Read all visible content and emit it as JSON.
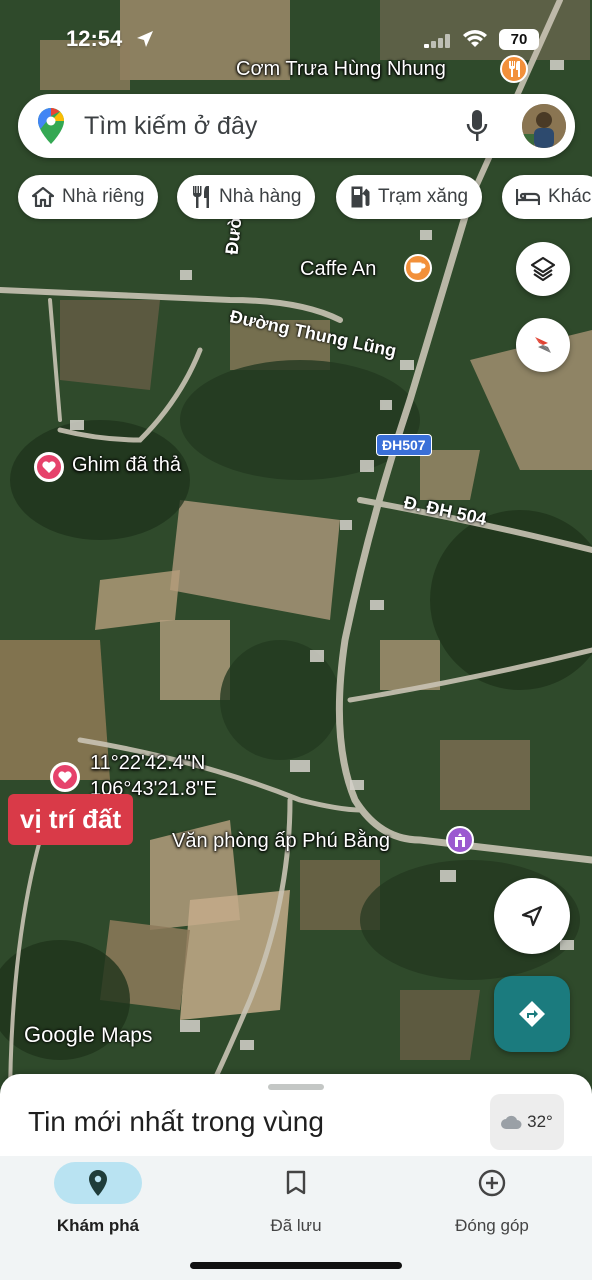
{
  "status_bar": {
    "time": "12:54",
    "battery": "70"
  },
  "search": {
    "placeholder": "Tìm kiếm ở đây"
  },
  "chips": [
    {
      "label": "Nhà riêng",
      "icon": "home-icon"
    },
    {
      "label": "Nhà hàng",
      "icon": "restaurant-icon"
    },
    {
      "label": "Trạm xăng",
      "icon": "gas-station-icon"
    },
    {
      "label": "Khác",
      "icon": "hotel-icon"
    }
  ],
  "map": {
    "pois": {
      "restaurant": "Cơm Trưa Hùng Nhung",
      "cafe": "Caffe An",
      "dropped_pin": "Ghim đã thả",
      "office": "Văn phòng ấp Phú Bằng"
    },
    "roads": {
      "duong_vertical": "Đường",
      "thung_lung": "Đường Thung Lũng",
      "dh507": "ĐH507",
      "dh504": "Đ. ĐH 504"
    },
    "coordinates": {
      "lat": "11°22'42.4\"N",
      "lng": "106°43'21.8\"E"
    },
    "marker_label": "vị trí đất",
    "watermark_google": "Google",
    "watermark_maps": "Maps"
  },
  "sheet": {
    "title": "Tin mới nhất trong vùng",
    "temperature": "32°"
  },
  "nav": [
    {
      "label": "Khám phá",
      "icon": "explore-pin-icon",
      "active": true
    },
    {
      "label": "Đã lưu",
      "icon": "bookmark-icon",
      "active": false
    },
    {
      "label": "Đóng góp",
      "icon": "add-circle-icon",
      "active": false
    }
  ],
  "colors": {
    "accent_teal": "#1b7b7e",
    "pin_pink": "#e6426b",
    "label_red": "#d93a48",
    "nav_active": "#b9e3f2"
  }
}
